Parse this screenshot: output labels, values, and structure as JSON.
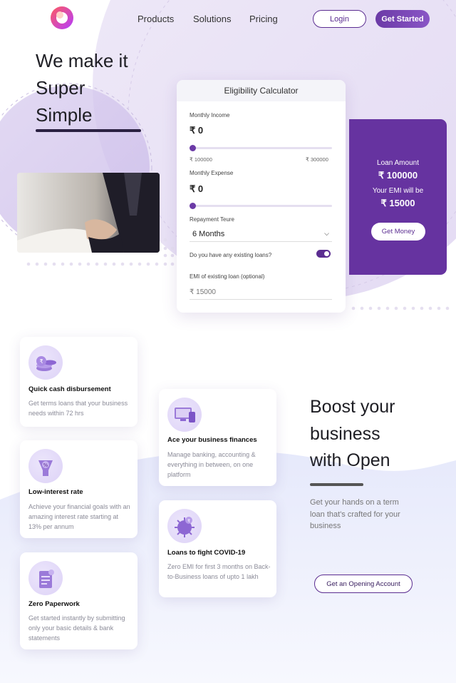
{
  "nav": {
    "links": [
      "Products",
      "Solutions",
      "Pricing"
    ],
    "login_label": "Login",
    "get_started_label": "Get Started"
  },
  "hero": {
    "title_lines": [
      "We make it",
      "Super",
      "Simple"
    ]
  },
  "calculator": {
    "title": "Eligibility Calculator",
    "monthly_income_label": "Monthly Income",
    "monthly_income_value": "₹ 0",
    "income_range_min": "₹ 100000",
    "income_range_max": "₹ 300000",
    "monthly_expense_label": "Monthly Expense",
    "monthly_expense_value": "₹ 0",
    "repayment_label": "Repayment Teure",
    "repayment_value": "6 Months",
    "existing_loans_label": "Do you have any existing loans?",
    "existing_loans_toggle": true,
    "emi_label": "EMI of existing loan (optional)",
    "emi_placeholder": "₹ 15000",
    "income_level": 0,
    "expense_level": 0
  },
  "loan_panel": {
    "loan_amount_label": "Loan Amount",
    "loan_amount_value": "₹ 100000",
    "emi_label": "Your EMI will be",
    "emi_value": "₹ 15000",
    "button_label": "Get Money"
  },
  "features": [
    {
      "title": "Quick cash disbursement",
      "desc": "Get terms loans that your business needs within 72 hrs",
      "icon": "coins-icon"
    },
    {
      "title": "Low-interest rate",
      "desc": "Achieve your financial goals with an amazing interest rate starting at 13% per annum",
      "icon": "percent-icon"
    },
    {
      "title": "Zero Paperwork",
      "desc": "Get started instantly by submitting only your basic details & bank statements",
      "icon": "document-icon"
    },
    {
      "title": "Ace your business finances",
      "desc": "Manage banking, accounting & everything in between, on one platform",
      "icon": "devices-icon"
    },
    {
      "title": "Loans to fight COVID-19",
      "desc": "Zero EMI for first 3 months on Back-to-Business loans of upto 1 lakh",
      "icon": "virus-icon"
    }
  ],
  "boost": {
    "title_lines": [
      "Boost your",
      "business",
      "with Open"
    ],
    "desc": "Get your hands on a term loan that's crafted for your business",
    "button_label": "Get an Opening Account"
  },
  "colors": {
    "brand_purple": "#6633a0",
    "accent_purple": "#5b2d91",
    "soft_lavender": "#e8e1f5"
  }
}
